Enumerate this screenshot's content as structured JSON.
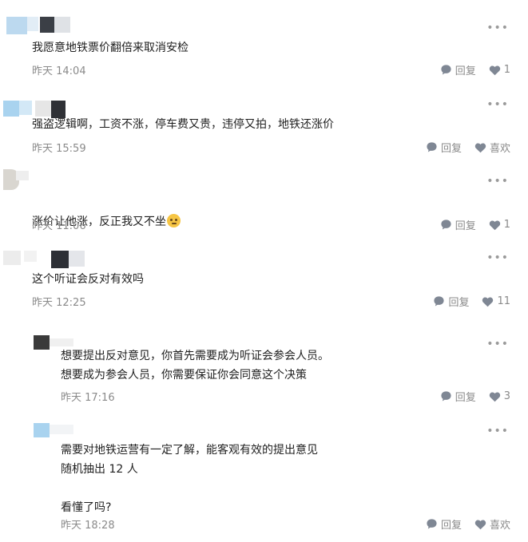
{
  "comments": [
    {
      "text": "我愿意地铁票价翻倍来取消安检",
      "time": "昨天 14:04",
      "reply_label": "回复",
      "like_label": "1"
    },
    {
      "text": "强盗逻辑啊，工资不涨，停车费又贵，违停又拍，地铁还涨价",
      "time": "昨天 15:59",
      "reply_label": "回复",
      "like_label": "喜欢"
    },
    {
      "text": "涨价让他涨，反正我又不坐",
      "emoji": "thinking-face-emoji",
      "time": "昨天 11:06",
      "reply_label": "回复",
      "like_label": "1"
    },
    {
      "text": "这个听证会反对有效吗",
      "time": "昨天 12:25",
      "reply_label": "回复",
      "like_label": "11"
    }
  ],
  "replies": [
    {
      "text": "想要提出反对意见，你首先需要成为听证会参会人员。\n想要成为参会人员，你需要保证你会同意这个决策",
      "time": "昨天 17:16",
      "reply_label": "回复",
      "like_label": "3"
    },
    {
      "text": "需要对地铁运营有一定了解，能客观有效的提出意见\n随机抽出 12 人\n\n看懂了吗?",
      "time": "昨天 18:28",
      "reply_label": "回复",
      "like_label": "喜欢"
    }
  ],
  "icons": {
    "more": "more-icon",
    "reply": "reply-bubble-icon",
    "like": "heart-icon"
  },
  "colors": {
    "text": "#1f1f1f",
    "meta": "#8a8a8a",
    "icon": "#7f8794",
    "background": "#ffffff"
  }
}
